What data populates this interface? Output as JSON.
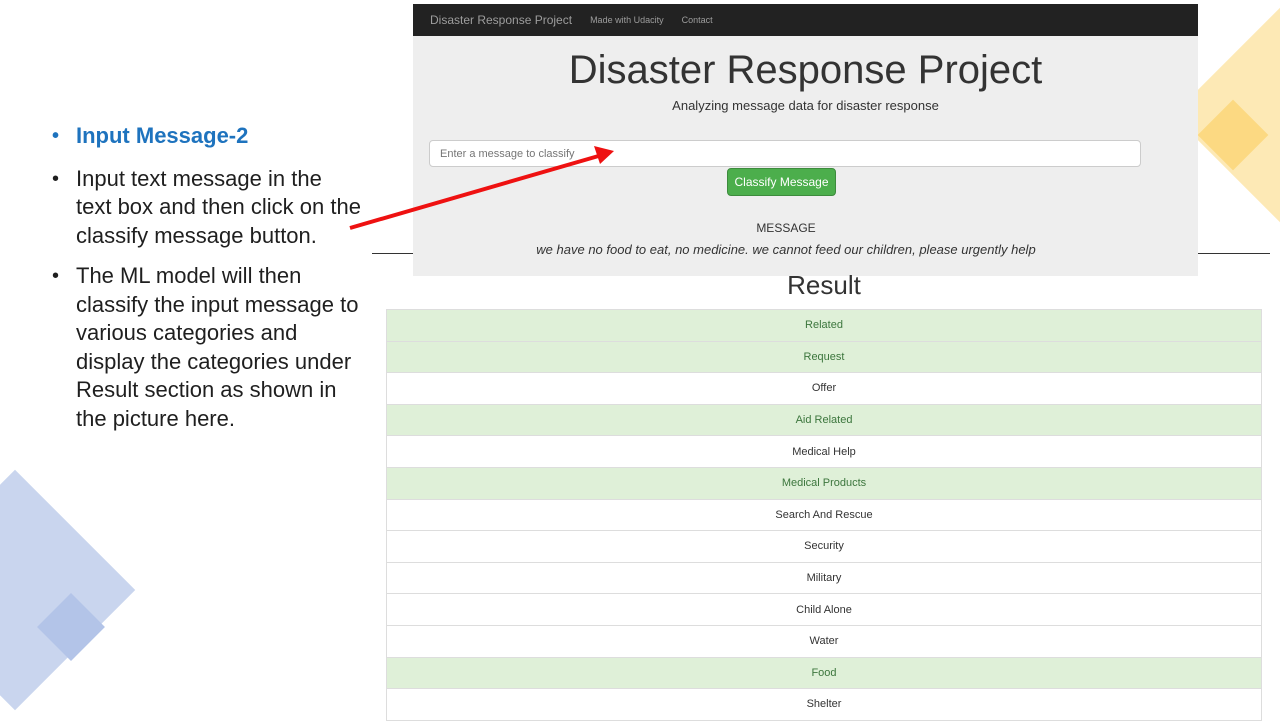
{
  "slide": {
    "bullets": [
      {
        "text": "Input Message-2",
        "title": true
      },
      {
        "text": "Input text message in the text box and then click on the classify message button.",
        "title": false
      },
      {
        "text": "The ML model will then classify the input message to various categories and display the categories under Result section as shown in the picture here.",
        "title": false
      }
    ]
  },
  "app": {
    "navbar": {
      "brand": "Disaster Response Project",
      "links": [
        "Made with Udacity",
        "Contact"
      ]
    },
    "title": "Disaster Response Project",
    "subtitle": "Analyzing message data for disaster response",
    "input": {
      "placeholder": "Enter a message to classify",
      "value": ""
    },
    "classify_button": "Classify Message",
    "message_label": "MESSAGE",
    "message_text": "we have no food to eat, no medicine. we cannot feed our children, please urgently help"
  },
  "result": {
    "title": "Result",
    "categories": [
      {
        "label": "Related",
        "positive": true
      },
      {
        "label": "Request",
        "positive": true
      },
      {
        "label": "Offer",
        "positive": false
      },
      {
        "label": "Aid Related",
        "positive": true
      },
      {
        "label": "Medical Help",
        "positive": false
      },
      {
        "label": "Medical Products",
        "positive": true
      },
      {
        "label": "Search And Rescue",
        "positive": false
      },
      {
        "label": "Security",
        "positive": false
      },
      {
        "label": "Military",
        "positive": false
      },
      {
        "label": "Child Alone",
        "positive": false
      },
      {
        "label": "Water",
        "positive": false
      },
      {
        "label": "Food",
        "positive": true
      },
      {
        "label": "Shelter",
        "positive": false
      }
    ]
  },
  "colors": {
    "positive_bg": "#dff0d8",
    "positive_text": "#3c763d",
    "button_green": "#4cae4c",
    "arrow_red": "#ee1111",
    "title_blue": "#1e73be"
  }
}
